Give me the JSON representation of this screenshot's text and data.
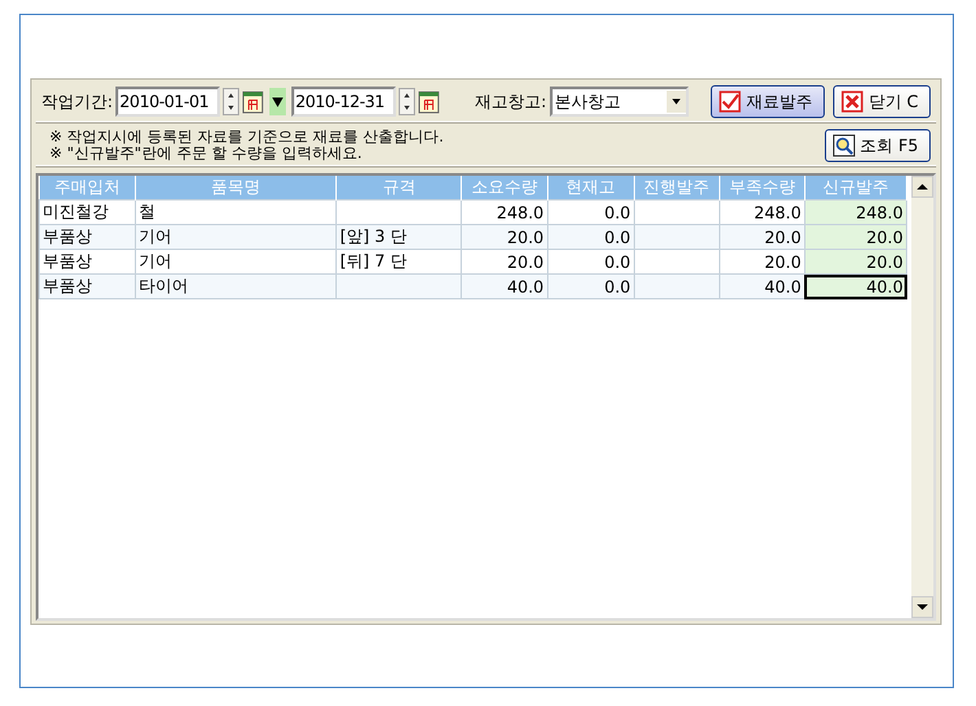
{
  "toolbar": {
    "period_label": "작업기간:",
    "date_from": "2010-01-01",
    "date_to": "2010-12-31",
    "warehouse_label": "재고창고:",
    "warehouse": "본사창고",
    "buttons": [
      {
        "kind": "check",
        "label": "재료발주",
        "selected": true
      },
      {
        "kind": "close",
        "label": "닫기 C",
        "selected": false
      }
    ]
  },
  "notes": [
    "※ 작업지시에 등록된 자료를 기준으로 재료를 산출합니다.",
    "※ \"신규발주\"란에 주문 할 수량을 입력하세요."
  ],
  "search_button": "조회 F5",
  "table": {
    "columns": [
      "주매입처",
      "품목명",
      "규격",
      "소요수량",
      "현재고",
      "진행발주",
      "부족수량",
      "신규발주"
    ],
    "rows": [
      {
        "cells": [
          "미진철강",
          "철",
          "",
          "248.0",
          "0.0",
          "",
          "248.0",
          "248.0"
        ],
        "focused": false
      },
      {
        "cells": [
          "부품상",
          "기어",
          "[앞] 3 단",
          "20.0",
          "0.0",
          "",
          "20.0",
          "20.0"
        ],
        "focused": false
      },
      {
        "cells": [
          "부품상",
          "기어",
          "[뒤] 7 단",
          "20.0",
          "0.0",
          "",
          "20.0",
          "20.0"
        ],
        "focused": false
      },
      {
        "cells": [
          "부품상",
          "타이어",
          "",
          "40.0",
          "0.0",
          "",
          "40.0",
          "40.0"
        ],
        "focused": true
      }
    ]
  }
}
